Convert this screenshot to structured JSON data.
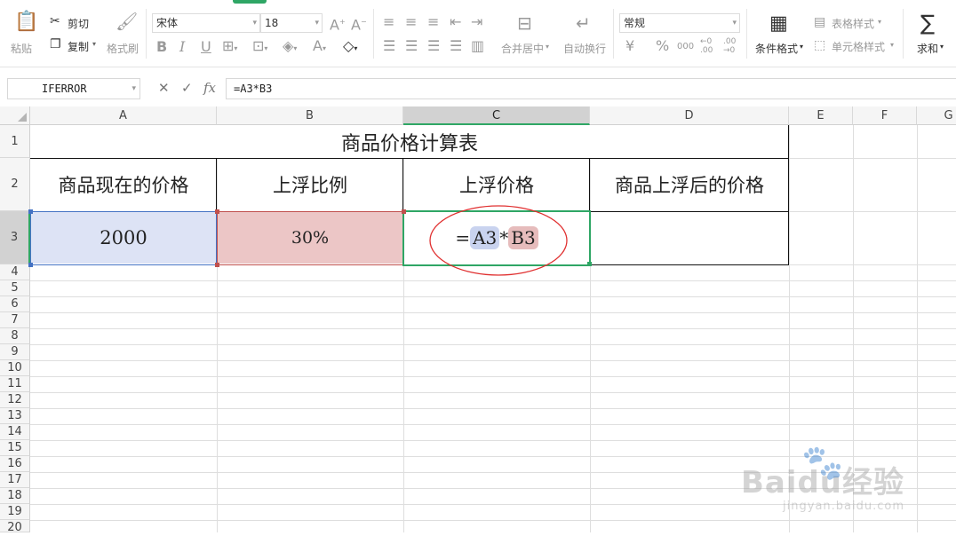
{
  "ribbon": {
    "paste": "粘贴",
    "cut": "剪切",
    "copy": "复制",
    "format_painter": "格式刷",
    "font_name": "宋体",
    "font_size": "18",
    "merge_center": "合并居中",
    "wrap_text": "自动换行",
    "number_format": "常规",
    "currency": "¥",
    "percent": "%",
    "thousands": "000",
    "inc_decimal": "←0 .00",
    "dec_decimal": ".00 →0",
    "cond_format": "条件格式",
    "table_style": "表格样式",
    "cell_style": "单元格样式",
    "sum": "求和"
  },
  "formula_bar": {
    "name_box": "IFERROR",
    "cancel": "✕",
    "confirm": "✓",
    "fx": "fx",
    "formula": "=A3*B3"
  },
  "columns": [
    "A",
    "B",
    "C",
    "D",
    "E",
    "F",
    "G"
  ],
  "rows": [
    "1",
    "2",
    "3",
    "4",
    "5",
    "6",
    "7",
    "8",
    "9",
    "10",
    "11",
    "12",
    "13",
    "14",
    "15",
    "16",
    "17",
    "18",
    "19",
    "20"
  ],
  "sheet": {
    "title": "商品价格计算表",
    "headers": [
      "商品现在的价格",
      "上浮比例",
      "上浮价格",
      "商品上浮后的价格"
    ],
    "a3": "2000",
    "b3": "30%",
    "c3_eq": "=",
    "c3_ref1": "A3",
    "c3_op": "*",
    "c3_ref2": "B3",
    "d3": ""
  },
  "watermark": {
    "brand": "Baidu经验",
    "url": "jingyan.baidu.com"
  },
  "colors": {
    "accent_green": "#2fa665",
    "ref_blue_fill": "#dde3f5",
    "ref_blue_border": "#4472c4",
    "ref_red_fill": "#ecc6c6",
    "ref_red_border": "#c0504d",
    "annotation_circle": "#e03030"
  }
}
